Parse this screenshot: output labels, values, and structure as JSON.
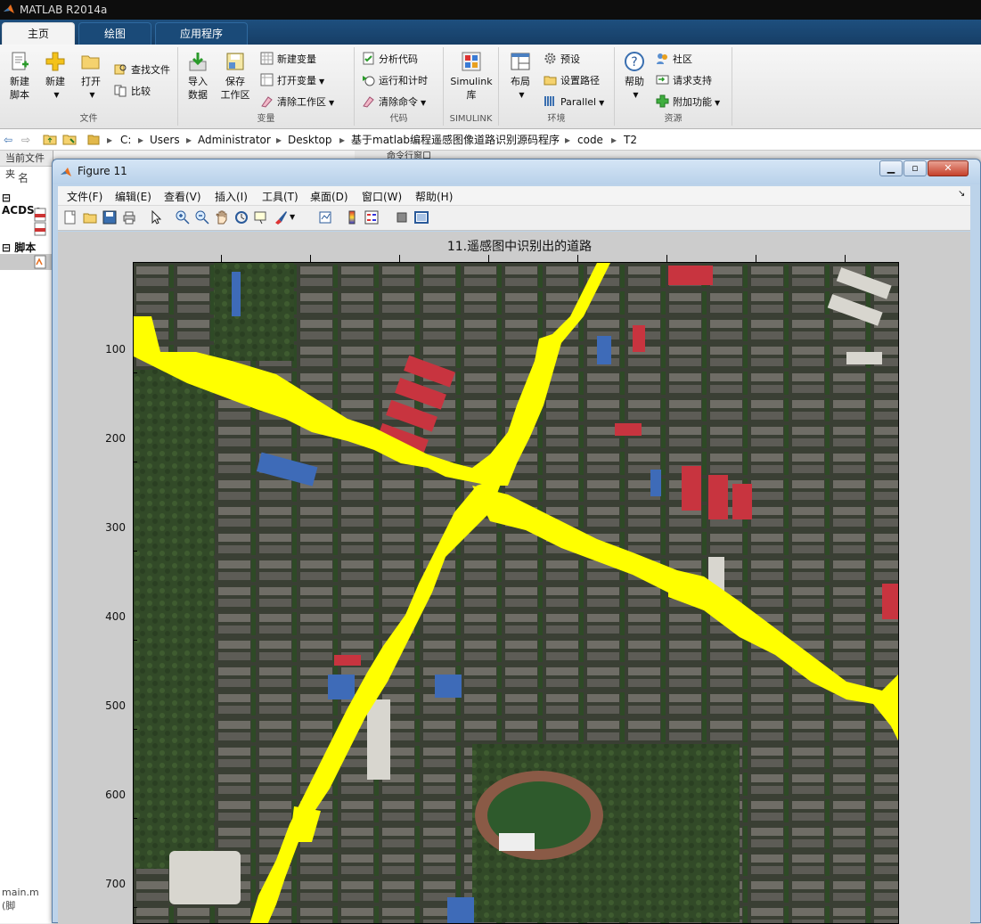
{
  "app": {
    "title": "MATLAB R2014a"
  },
  "main_tabs": [
    {
      "label": "主页"
    },
    {
      "label": "绘图"
    },
    {
      "label": "应用程序"
    }
  ],
  "ribbon": {
    "file_group": {
      "label": "文件",
      "new_script": "新建\n脚本",
      "new": "新建",
      "open": "打开",
      "find_files": "查找文件",
      "compare": "比较"
    },
    "variable_group": {
      "label": "变量",
      "import": "导入\n数据",
      "save_workspace": "保存\n工作区",
      "new_variable": "新建变量",
      "open_variable": "打开变量",
      "clear_workspace": "清除工作区"
    },
    "code_group": {
      "label": "代码",
      "analyze": "分析代码",
      "run_time": "运行和计时",
      "clear_commands": "清除命令"
    },
    "simulink_group": {
      "label": "SIMULINK",
      "simulink": "Simulink\n库"
    },
    "env_group": {
      "label": "环境",
      "layout": "布局",
      "preferences": "预设",
      "set_path": "设置路径",
      "parallel": "Parallel"
    },
    "resources_group": {
      "label": "资源",
      "help": "帮助",
      "community": "社区",
      "request_support": "请求支持",
      "addons": "附加功能"
    }
  },
  "path": {
    "segments": [
      "C:",
      "Users",
      "Administrator",
      "Desktop",
      "基于matlab编程遥感图像道路识别源码程序",
      "code",
      "T2"
    ]
  },
  "left_panel": {
    "header": "当前文件夹",
    "name_col": "名",
    "folder1": "ACDSe",
    "scripts": "脚本",
    "footer": "main.m (脚"
  },
  "command_window": {
    "label": "命令行窗口"
  },
  "figure": {
    "title": "Figure 11",
    "menus": [
      "文件(F)",
      "编辑(E)",
      "查看(V)",
      "插入(I)",
      "工具(T)",
      "桌面(D)",
      "窗口(W)",
      "帮助(H)"
    ],
    "axes_title": "11.遥感图中识别出的道路",
    "yticks": [
      "100",
      "200",
      "300",
      "400",
      "500",
      "600",
      "700"
    ]
  },
  "colors": {
    "road": "#ffff00",
    "ribbon_blue": "#1a4a78",
    "figure_bg": "#cccccc"
  }
}
